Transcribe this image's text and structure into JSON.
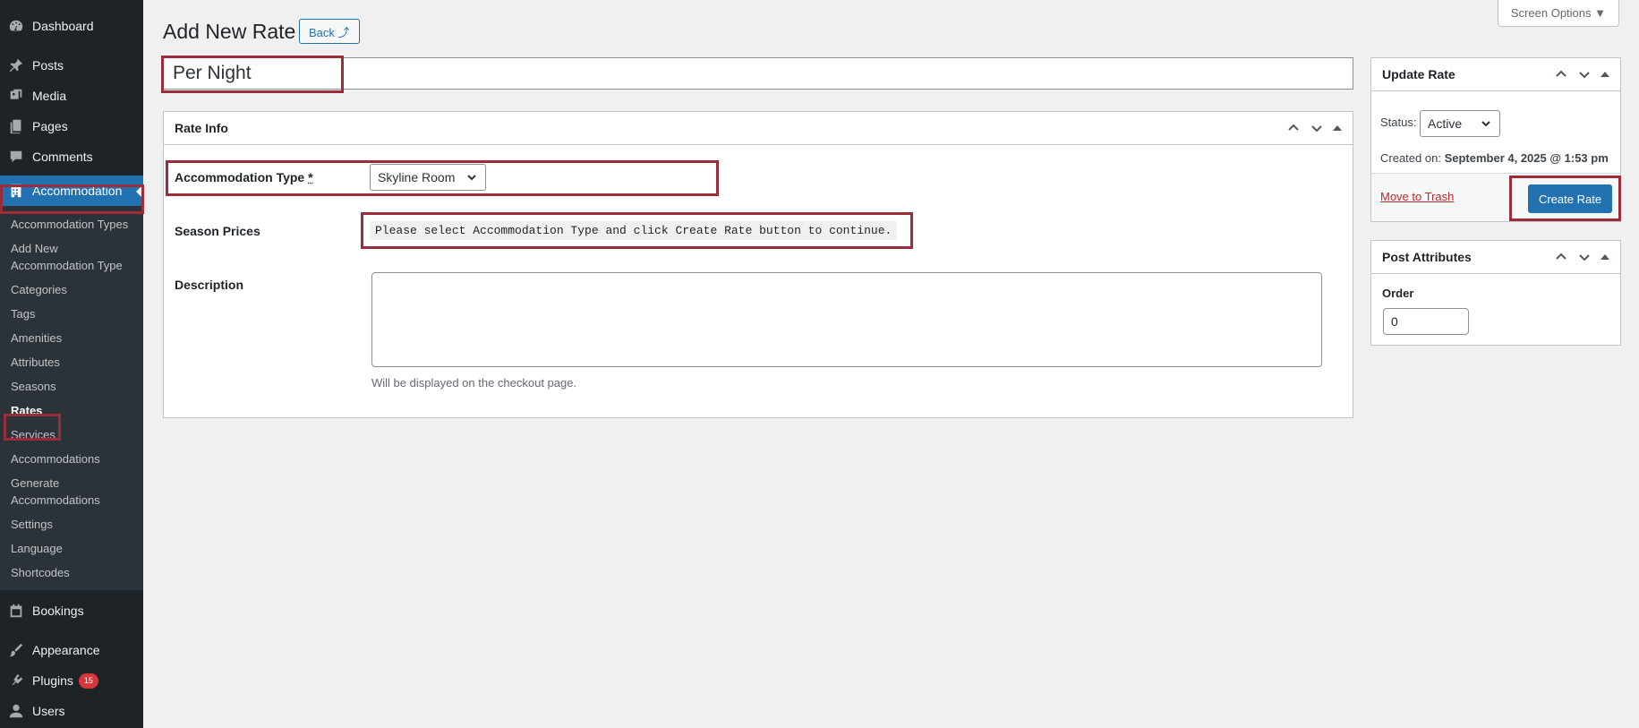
{
  "sidebar": {
    "top_items": [
      {
        "label": "Dashboard",
        "icon": "dashboard-icon"
      },
      {
        "label": "Posts",
        "icon": "pin-icon"
      },
      {
        "label": "Media",
        "icon": "media-icon"
      },
      {
        "label": "Pages",
        "icon": "pages-icon"
      },
      {
        "label": "Comments",
        "icon": "comments-icon"
      },
      {
        "label": "Accommodation",
        "icon": "building-icon"
      }
    ],
    "submenu": [
      "Accommodation Types",
      "Add New Accommodation Type",
      "Categories",
      "Tags",
      "Amenities",
      "Attributes",
      "Seasons",
      "Rates",
      "Services",
      "Accommodations",
      "Generate Accommodations",
      "Settings",
      "Language",
      "Shortcodes"
    ],
    "bottom_items": [
      {
        "label": "Bookings",
        "icon": "calendar-icon"
      },
      {
        "label": "Appearance",
        "icon": "brush-icon"
      },
      {
        "label": "Plugins",
        "icon": "plugin-icon",
        "badge": "15"
      },
      {
        "label": "Users",
        "icon": "users-icon"
      }
    ]
  },
  "header": {
    "title": "Add New Rate",
    "back_label": "Back ⤴",
    "screen_options": "Screen Options ▼"
  },
  "post": {
    "title_value": "Per Night"
  },
  "rate_info": {
    "title": "Rate Info",
    "accommodation_type_label": "Accommodation Type",
    "required_mark": "*",
    "accommodation_type_value": "Skyline Room",
    "season_prices_label": "Season Prices",
    "season_prices_note": "Please select Accommodation Type and click Create Rate button to continue.",
    "description_label": "Description",
    "description_hint": "Will be displayed on the checkout page."
  },
  "update_rate": {
    "title": "Update Rate",
    "status_label": "Status:",
    "status_value": "Active",
    "created_label": "Created on:",
    "created_value": "September 4, 2025 @ 1:53 pm",
    "trash_label": "Move to Trash",
    "create_label": "Create Rate"
  },
  "post_attributes": {
    "title": "Post Attributes",
    "order_label": "Order",
    "order_value": "0"
  },
  "colors": {
    "accent": "#2271b1",
    "sidebar_bg": "#1d2327",
    "highlight_box": "#9b2c3a"
  }
}
